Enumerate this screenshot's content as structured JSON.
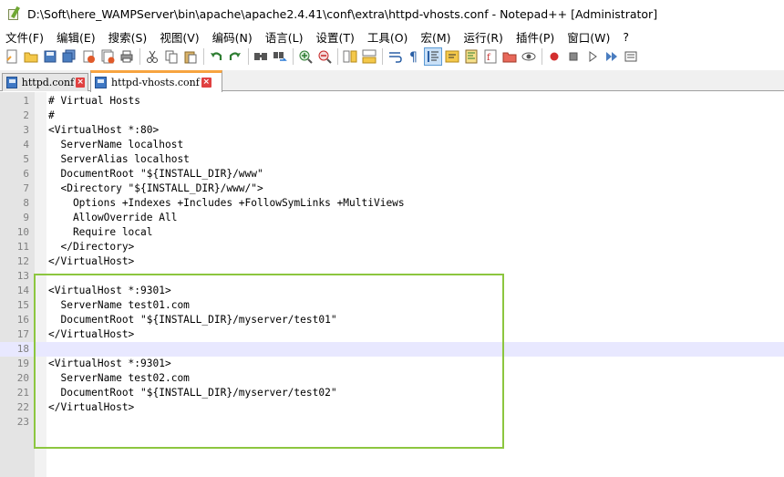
{
  "window": {
    "title": "D:\\Soft\\here_WAMPServer\\bin\\apache\\apache2.4.41\\conf\\extra\\httpd-vhosts.conf - Notepad++ [Administrator]"
  },
  "menu": [
    "文件(F)",
    "编辑(E)",
    "搜索(S)",
    "视图(V)",
    "编码(N)",
    "语言(L)",
    "设置(T)",
    "工具(O)",
    "宏(M)",
    "运行(R)",
    "插件(P)",
    "窗口(W)",
    "?"
  ],
  "toolbar": {
    "icons": [
      "new-file-icon",
      "open-file-icon",
      "save-icon",
      "save-all-icon",
      "close-icon",
      "close-all-icon",
      "print-icon",
      "sep",
      "cut-icon",
      "copy-icon",
      "paste-icon",
      "sep",
      "undo-icon",
      "redo-icon",
      "sep",
      "find-icon",
      "replace-icon",
      "sep",
      "zoom-in-icon",
      "zoom-out-icon",
      "sep",
      "sync-vertical-icon",
      "sync-horizontal-icon",
      "sep",
      "word-wrap-icon",
      "show-all-chars-icon",
      "indent-guide-icon",
      "lang-udl-icon",
      "doc-map-icon",
      "function-list-icon",
      "folder-workspace-icon",
      "monitoring-icon",
      "sep",
      "record-macro-icon",
      "stop-macro-icon",
      "play-macro-icon",
      "run-macro-multiple-icon",
      "save-macro-icon"
    ],
    "active_icon": "indent-guide-icon"
  },
  "tabs": [
    {
      "label": "httpd.conf",
      "active": false
    },
    {
      "label": "httpd-vhosts.conf",
      "active": true
    }
  ],
  "editor": {
    "current_line": 18,
    "lines": [
      {
        "n": "1",
        "text": "# Virtual Hosts"
      },
      {
        "n": "2",
        "text": "#"
      },
      {
        "n": "3",
        "text": "<VirtualHost *:80>"
      },
      {
        "n": "4",
        "text": "  ServerName localhost"
      },
      {
        "n": "5",
        "text": "  ServerAlias localhost"
      },
      {
        "n": "6",
        "text": "  DocumentRoot \"${INSTALL_DIR}/www\""
      },
      {
        "n": "7",
        "text": "  <Directory \"${INSTALL_DIR}/www/\">"
      },
      {
        "n": "8",
        "text": "    Options +Indexes +Includes +FollowSymLinks +MultiViews"
      },
      {
        "n": "9",
        "text": "    AllowOverride All"
      },
      {
        "n": "10",
        "text": "    Require local"
      },
      {
        "n": "11",
        "text": "  </Directory>"
      },
      {
        "n": "12",
        "text": "</VirtualHost>"
      },
      {
        "n": "13",
        "text": ""
      },
      {
        "n": "14",
        "text": "<VirtualHost *:9301>"
      },
      {
        "n": "15",
        "text": "  ServerName test01.com"
      },
      {
        "n": "16",
        "text": "  DocumentRoot \"${INSTALL_DIR}/myserver/test01\""
      },
      {
        "n": "17",
        "text": "</VirtualHost>"
      },
      {
        "n": "18",
        "text": ""
      },
      {
        "n": "19",
        "text": "<VirtualHost *:9301>"
      },
      {
        "n": "20",
        "text": "  ServerName test02.com"
      },
      {
        "n": "21",
        "text": "  DocumentRoot \"${INSTALL_DIR}/myserver/test02\""
      },
      {
        "n": "22",
        "text": "</VirtualHost>"
      },
      {
        "n": "23",
        "text": ""
      }
    ]
  },
  "colors": {
    "highlight_box": "#8cc63f",
    "active_tab_accent": "#f7a440",
    "current_line_bg": "#e8e8ff"
  }
}
